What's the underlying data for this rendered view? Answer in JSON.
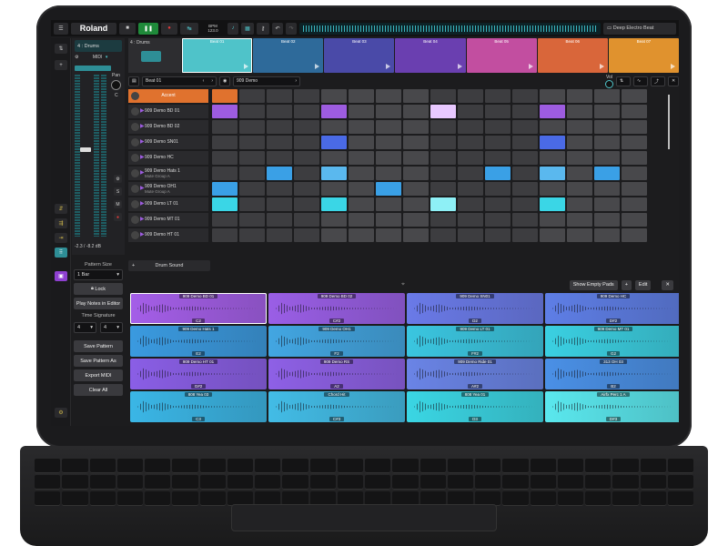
{
  "topbar": {
    "menu_icon": "hamburger-icon",
    "logo": "Roland",
    "bpm_label": "BPM",
    "bpm_value": "123.0",
    "project_name": "Deep Electro Beat"
  },
  "strip": {
    "channel": "4 : Drums",
    "input": "MIDI",
    "pan_label": "Pan",
    "pan_value": "C",
    "level": "-2.3 / -8.2 dB",
    "solo": "S",
    "mute": "M"
  },
  "side": {
    "pattern_size_label": "Pattern Size",
    "pattern_size": "1 Bar",
    "lock": "Lock",
    "play_notes": "Play Notes in Editor",
    "time_sig_label": "Time Signature",
    "ts_num": "4",
    "ts_den": "4",
    "save_pattern": "Save Pattern",
    "save_pattern_as": "Save Pattern As",
    "export_midi": "Export MIDI",
    "clear_all": "Clear All"
  },
  "patterns": {
    "track_label": "4 : Drums",
    "items": [
      {
        "label": "Beat 01",
        "color": "#4fc3c9"
      },
      {
        "label": "Beat 02",
        "color": "#2e6a9a"
      },
      {
        "label": "Beat 03",
        "color": "#4a4aa8"
      },
      {
        "label": "Beat 04",
        "color": "#6a3fb0"
      },
      {
        "label": "Beat 05",
        "color": "#c24ea0"
      },
      {
        "label": "Beat 06",
        "color": "#d9663a"
      },
      {
        "label": "Beat 07",
        "color": "#e0922e"
      }
    ]
  },
  "selectors": {
    "beat": "Beat 01",
    "kit": "909 Demo",
    "vol_label": "Vol"
  },
  "tracks": [
    {
      "name": "Accent",
      "sub": "",
      "accent": true
    },
    {
      "name": "909 Demo BD 01",
      "sub": ""
    },
    {
      "name": "909 Demo BD 02",
      "sub": ""
    },
    {
      "name": "909 Demo SN01",
      "sub": ""
    },
    {
      "name": "909 Demo HC",
      "sub": ""
    },
    {
      "name": "909 Demo Hats 1",
      "sub": "Mute Group A"
    },
    {
      "name": "909 Demo OH1",
      "sub": "Mute Group A"
    },
    {
      "name": "909 Demo LT 01",
      "sub": ""
    },
    {
      "name": "909 Demo MT 01",
      "sub": ""
    },
    {
      "name": "909 Demo HT 01",
      "sub": ""
    }
  ],
  "steps": {
    "0": {
      "0": "#e0722e"
    },
    "1": {
      "0": "#9d5ce0",
      "4": "#9d5ce0",
      "8": "#e8c8ff",
      "12": "#9d5ce0"
    },
    "3": {
      "4": "#4a6ae6",
      "12": "#4a6ae6"
    },
    "5": {
      "2": "#3aa0e6",
      "4": "#5ab8ee",
      "10": "#3aa0e6",
      "12": "#5ab8ee",
      "14": "#3aa0e6"
    },
    "6": {
      "0": "#3aa0e6",
      "6": "#3aa0e6"
    },
    "7": {
      "0": "#3ad6e6",
      "4": "#3ad6e6",
      "8": "#8ef0f6",
      "12": "#3ad6e6"
    }
  },
  "drum_sound_label": "Drum Sound",
  "padbar": {
    "show_empty": "Show Empty Pads",
    "edit": "Edit"
  },
  "pads": [
    {
      "name": "909 Demo BD 01",
      "note": "C2",
      "color": "#a45ee8"
    },
    {
      "name": "909 Demo BD 02",
      "note": "C#2",
      "color": "#9a5ee6"
    },
    {
      "name": "909 Demo SN01",
      "note": "D2",
      "color": "#6a7ae8"
    },
    {
      "name": "909 Demo HC",
      "note": "D#2",
      "color": "#5e7ee6"
    },
    {
      "name": "909 Demo Hats 1",
      "note": "E2",
      "color": "#3a9ae0"
    },
    {
      "name": "909 Demo OH1",
      "note": "F2",
      "color": "#42a6e2"
    },
    {
      "name": "909 Demo LT 01",
      "note": "F#2",
      "color": "#3ac6e0"
    },
    {
      "name": "909 Demo MT 01",
      "note": "G2",
      "color": "#3ad0e2"
    },
    {
      "name": "909 Demo HT 01",
      "note": "G#2",
      "color": "#8a5ee6"
    },
    {
      "name": "909 Demo RS",
      "note": "A2",
      "color": "#8e60e6"
    },
    {
      "name": "909 Demo Ride 01",
      "note": "A#2",
      "color": "#6a84e6"
    },
    {
      "name": "313 OH 03",
      "note": "B2",
      "color": "#4a90e6"
    },
    {
      "name": "808 Yea 03",
      "note": "C3",
      "color": "#3ab6e6"
    },
    {
      "name": "Chord Hit",
      "note": "C#3",
      "color": "#42bce6"
    },
    {
      "name": "808 Yea 01",
      "note": "D3",
      "color": "#3ad6e4"
    },
    {
      "name": "Airfx Perc 1 A",
      "note": "D#3",
      "color": "#5ae8ee"
    }
  ],
  "colors": {
    "accent": "#e0722e",
    "play": "#1f8a3a",
    "record": "#e23a3a",
    "panel": "#1c1c1e"
  }
}
